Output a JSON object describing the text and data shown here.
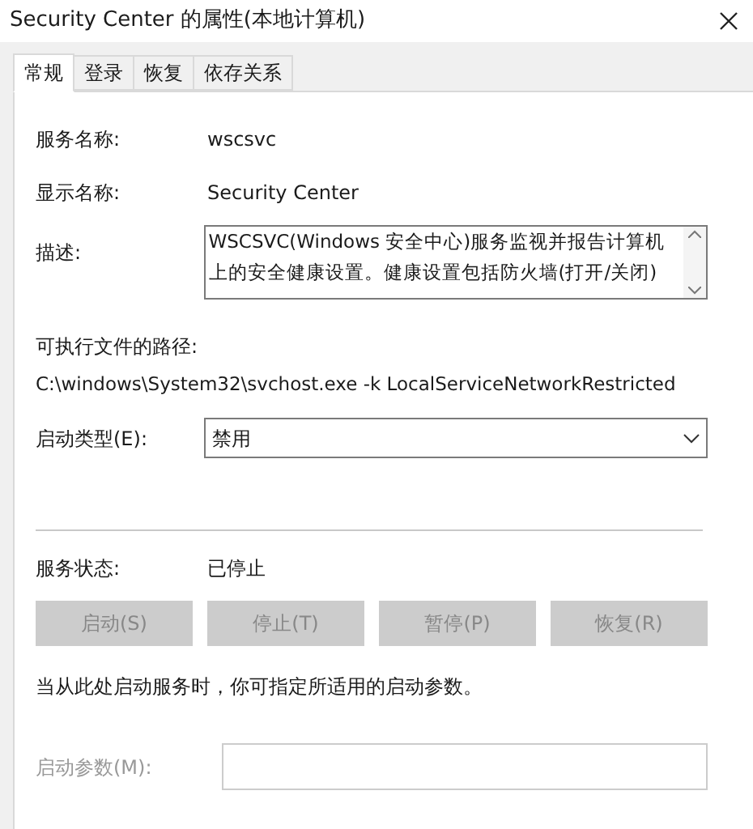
{
  "window": {
    "title": "Security Center 的属性(本地计算机)"
  },
  "tabs": [
    {
      "label": "常规",
      "selected": true
    },
    {
      "label": "登录",
      "selected": false
    },
    {
      "label": "恢复",
      "selected": false
    },
    {
      "label": "依存关系",
      "selected": false
    }
  ],
  "service_name": {
    "label": "服务名称:",
    "value": "wscsvc"
  },
  "display_name": {
    "label": "显示名称:",
    "value": "Security Center"
  },
  "description": {
    "label": "描述:",
    "value": "WSCSVC(Windows 安全中心)服务监视并报告计算机上的安全健康设置。健康设置包括防火墙(打开/关闭)"
  },
  "executable_path": {
    "label": "可执行文件的路径:",
    "value": "C:\\windows\\System32\\svchost.exe -k LocalServiceNetworkRestricted"
  },
  "startup_type": {
    "label": "启动类型(E):",
    "value": "禁用"
  },
  "service_status": {
    "label": "服务状态:",
    "value": "已停止"
  },
  "buttons": [
    {
      "label": "启动(S)",
      "disabled": true
    },
    {
      "label": "停止(T)",
      "disabled": true
    },
    {
      "label": "暂停(P)",
      "disabled": true
    },
    {
      "label": "恢复(R)",
      "disabled": true
    }
  ],
  "note": "当从此处启动服务时，你可指定所适用的启动参数。",
  "start_parameters": {
    "label": "启动参数(M):",
    "disabled": true
  }
}
